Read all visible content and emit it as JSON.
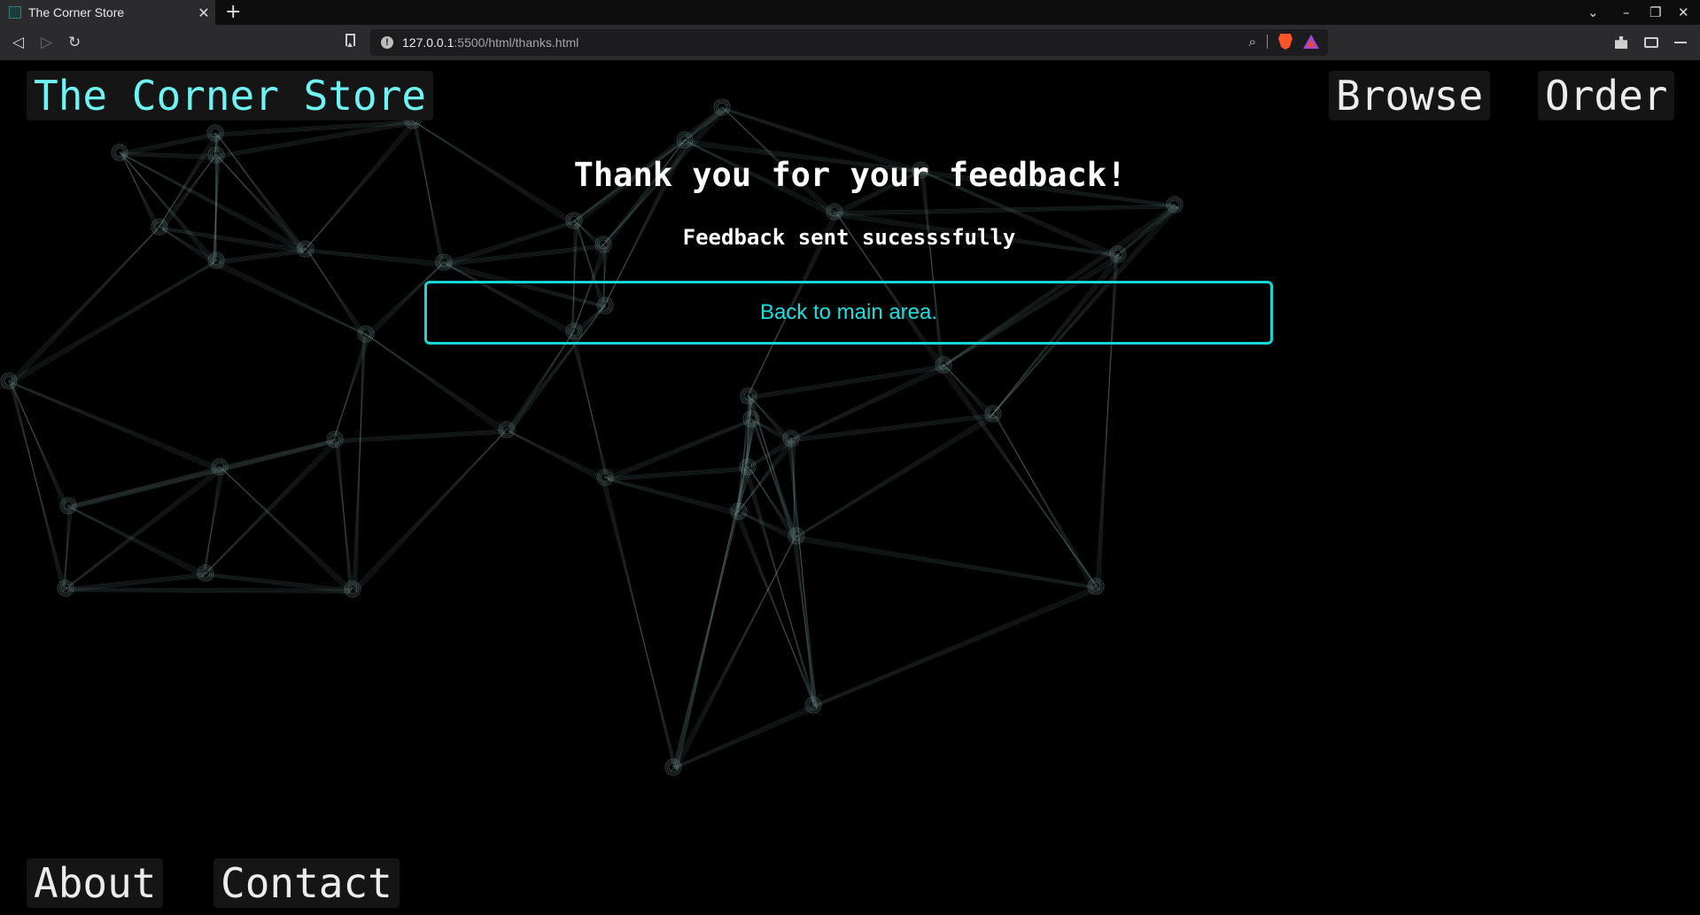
{
  "browser": {
    "tab_title": "The Corner Store",
    "tab_close": "✕",
    "new_tab": "+",
    "url_host": "127.0.0.1",
    "url_path": ":5500/html/thanks.html",
    "url_info": "!",
    "zoom": "⌕",
    "back": "◁",
    "forward": "▷",
    "reload": "↻",
    "tab_list": "⌄",
    "minimize": "–",
    "restore": "❐",
    "close": "✕"
  },
  "site": {
    "brand": "The Corner Store",
    "nav": [
      "Browse",
      "Order"
    ],
    "footer_nav": [
      "About",
      "Contact"
    ]
  },
  "content": {
    "title": "Thank you for your feedback!",
    "subtitle": "Feedback sent sucesssfully",
    "back_link": "Back to main area."
  },
  "colors": {
    "brand": "#6ff3f3",
    "accent": "#19d6d6",
    "background": "#000000",
    "network_lines": "#8fb4b4"
  }
}
